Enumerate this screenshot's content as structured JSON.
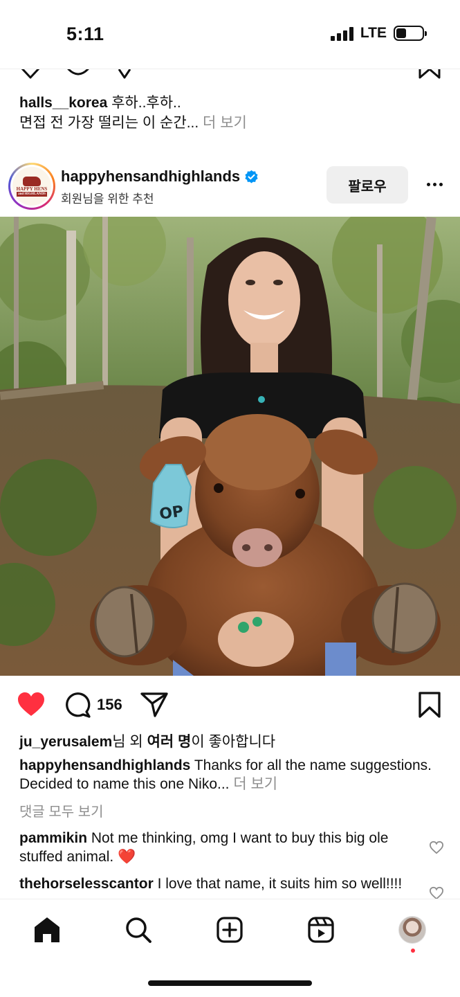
{
  "status_bar": {
    "time": "5:11",
    "network": "LTE",
    "battery_level": 0.4
  },
  "previous_post": {
    "username": "halls__korea",
    "caption_line1": "후하..후하..",
    "caption_line2": "면접 전 가장 떨리는 이 순간...",
    "more_label": "더 보기"
  },
  "post": {
    "username": "happyhensandhighlands",
    "verified": true,
    "subtitle": "회원님을 위한 추천",
    "follow_label": "팔로우",
    "avatar_text_1": "HAPPY HENS",
    "avatar_text_2": "and HIGHLANDS",
    "ear_tag": "OP",
    "liked": true,
    "comment_count": "156",
    "likes": {
      "user": "ju_yerusalem",
      "suffix_1": "님 외 ",
      "bold": "여러 명",
      "suffix_2": "이 좋아합니다"
    },
    "caption": {
      "username": "happyhensandhighlands",
      "text": " Thanks for all the name suggestions. Decided to name this one Niko...",
      "more_label": " 더 보기"
    },
    "view_all_comments": "댓글 모두 보기",
    "comments": [
      {
        "username": "pammikin",
        "text": " Not me thinking, omg I want to buy this big ole stuffed animal. ❤️"
      },
      {
        "username": "thehorselesscantor",
        "text": " I love that name, it suits him so well!!!!"
      }
    ]
  },
  "colors": {
    "like_red": "#ff3040",
    "verified_blue": "#0095f6",
    "muted_text": "#8e8e8e",
    "follow_bg": "#efefef"
  },
  "icons": {
    "like": "heart-icon",
    "comment": "comment-icon",
    "share": "share-icon",
    "save": "bookmark-icon",
    "nav": [
      "home-icon",
      "search-icon",
      "create-icon",
      "reels-icon",
      "profile-avatar"
    ]
  }
}
